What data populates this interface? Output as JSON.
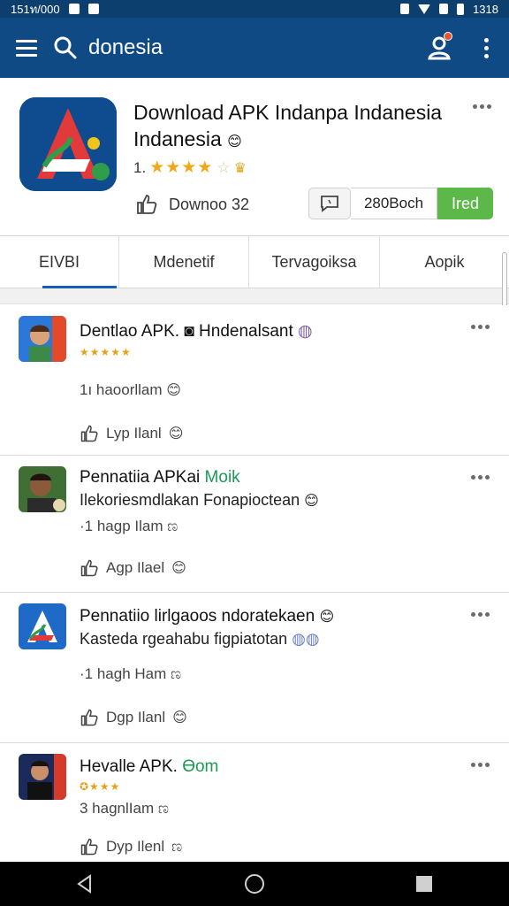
{
  "status_bar": {
    "time_left": "151ท/000",
    "clock": "1318"
  },
  "app_bar": {
    "search_query": "donesia",
    "menu_icon": "hamburger-icon",
    "search_icon": "search-icon",
    "account_icon": "account-alert-icon",
    "more_icon": "more-vertical-icon"
  },
  "header": {
    "title_line1": "Download APK Indanpa Indanesia",
    "title_line2": "Indanesia",
    "rating_prefix": "1.",
    "stars": "★★★★",
    "rating_suffix": "☆",
    "like_label": "Downoo 32",
    "size_value": "280Вoch",
    "action_label": "Ired"
  },
  "tabs": [
    {
      "label": "EIVBI",
      "active": true
    },
    {
      "label": "Mdenetif",
      "active": false
    },
    {
      "label": "Tervagoiksa",
      "active": false
    },
    {
      "label": "Aopik",
      "active": false
    }
  ],
  "feed": [
    {
      "title": "Dentlao APK. ◙ Hndenalsant",
      "stars": "★★★★★",
      "meta": "1ı haoorllam",
      "action": "Lyp Ilanl"
    },
    {
      "title": "Pennatiia APKai",
      "title_accent": "Moik",
      "subtitle": "Ilekoriesmdlakan Fonapioctean",
      "meta": "·1 hagp Ilam ಣ",
      "action": "Agp Ilael"
    },
    {
      "title": "Pennatiio lirlgaoos ndoratekaen",
      "subtitle": "Kasteda rgeahabu figpiatotan",
      "meta": "·1 hagh Ham ಣ",
      "action": "Dgp Ilanl"
    },
    {
      "title": "Hevalle APK.",
      "title_accent": "Ɵom",
      "stars": "✪★★★",
      "meta": "3 hagnlIam ಣ",
      "action": "Dyp Ilenl"
    }
  ],
  "colors": {
    "app_bar": "#0f4a85",
    "status_bar": "#0d3f6e",
    "accent_green": "#5db84a",
    "tab_indicator": "#1460b8",
    "star": "#f0a916"
  }
}
